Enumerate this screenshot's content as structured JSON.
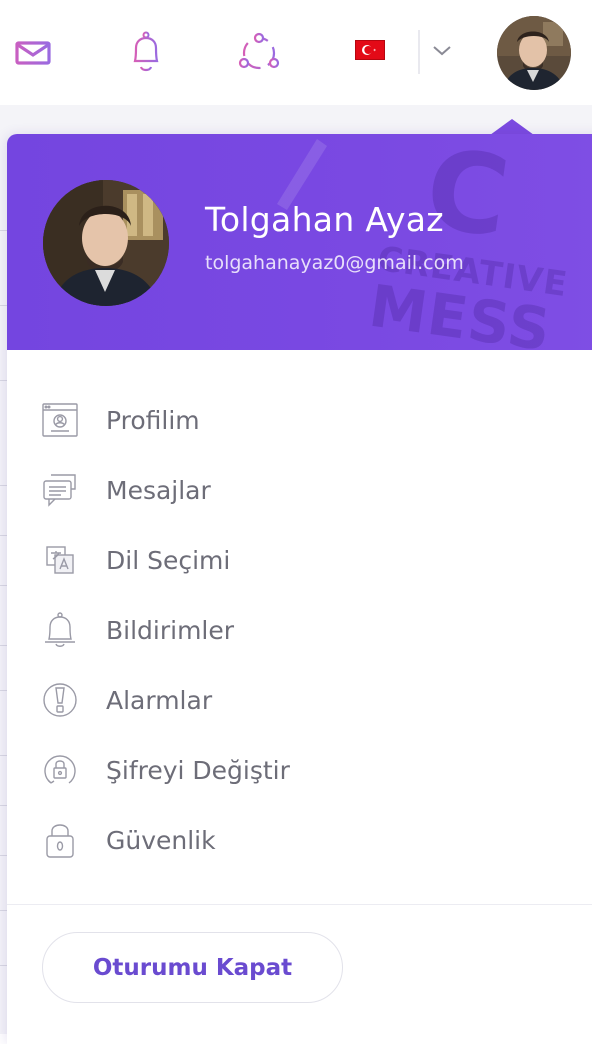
{
  "topbar": {
    "icons": [
      "mail-icon",
      "bell-icon",
      "share-network-icon"
    ],
    "language_flag": "turkey-flag",
    "dropdown_icon": "chevron-down-icon"
  },
  "profile": {
    "name": "Tolgahan Ayaz",
    "email": "tolgahanayaz0@gmail.com"
  },
  "header_background_text": [
    "C",
    "CREATIVE",
    "MESS"
  ],
  "menu": {
    "items": [
      {
        "label": "Profilim",
        "icon": "profile-card-icon"
      },
      {
        "label": "Mesajlar",
        "icon": "chat-bubbles-icon"
      },
      {
        "label": "Dil Seçimi",
        "icon": "translate-icon"
      },
      {
        "label": "Bildirimler",
        "icon": "bell-icon"
      },
      {
        "label": "Alarmlar",
        "icon": "alert-icon"
      },
      {
        "label": "Şifreyi Değiştir",
        "icon": "lock-refresh-icon"
      },
      {
        "label": "Güvenlik",
        "icon": "padlock-icon"
      }
    ]
  },
  "logout": {
    "label": "Oturumu Kapat"
  },
  "colors": {
    "accent": "#7445e0",
    "header_gradient_end": "#7f4ee4",
    "icon_pink": "#c760c4",
    "menu_text": "#6d6d78",
    "logout_text": "#6a4bd0"
  }
}
